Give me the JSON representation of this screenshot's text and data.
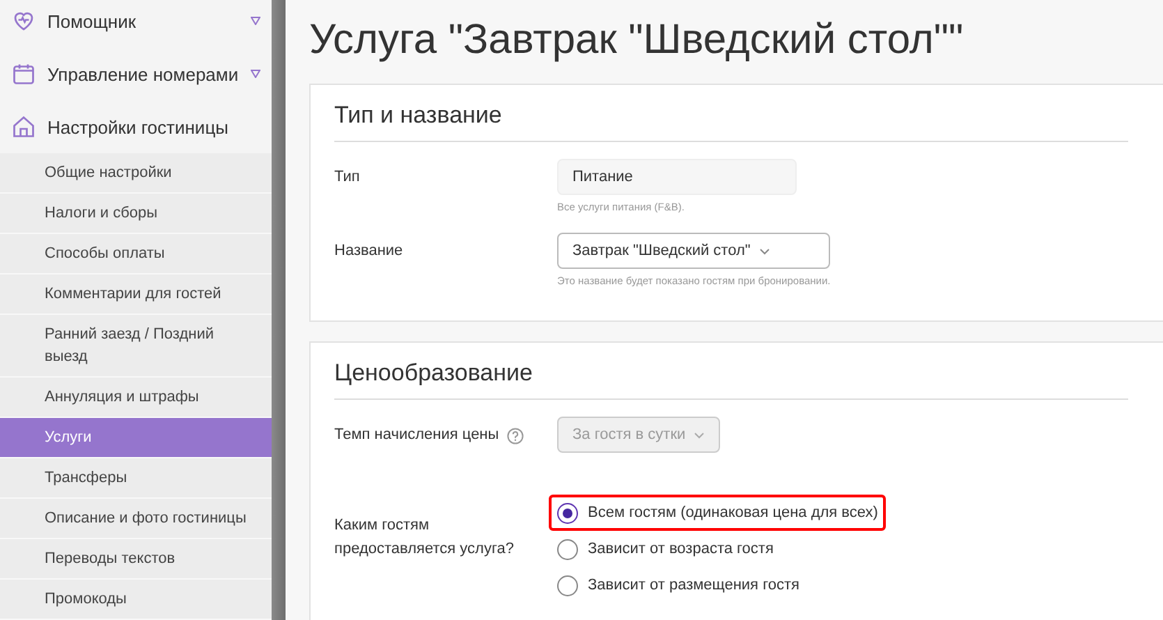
{
  "sidebar": {
    "items": [
      {
        "label": "Помощник",
        "expandable": true
      },
      {
        "label": "Управление номерами",
        "expandable": true
      },
      {
        "label": "Настройки гостиницы",
        "expandable": false,
        "children": [
          {
            "label": "Общие настройки",
            "selected": false
          },
          {
            "label": "Налоги и сборы",
            "selected": false
          },
          {
            "label": "Способы оплаты",
            "selected": false
          },
          {
            "label": "Комментарии для гостей",
            "selected": false
          },
          {
            "label": "Ранний заезд / Поздний выезд",
            "selected": false
          },
          {
            "label": "Аннуляция и штрафы",
            "selected": false
          },
          {
            "label": "Услуги",
            "selected": true
          },
          {
            "label": "Трансферы",
            "selected": false
          },
          {
            "label": "Описание и фото гостиницы",
            "selected": false
          },
          {
            "label": "Переводы текстов",
            "selected": false
          },
          {
            "label": "Промокоды",
            "selected": false
          }
        ]
      }
    ]
  },
  "page_title": "Услуга \"Завтрак \"Шведский стол\"\"",
  "sections": [
    {
      "title": "Тип и название",
      "fields": [
        {
          "kind": "input",
          "label": "Тип",
          "value": "Питание",
          "hint": "Все услуги питания (F&B)."
        },
        {
          "kind": "select",
          "label": "Название",
          "value": "Завтрак \"Шведский стол\"",
          "disabled": false,
          "hint": "Это название будет показано гостям при бронировании."
        }
      ]
    },
    {
      "title": "Ценообразование",
      "fields": [
        {
          "kind": "select",
          "label": "Темп начисления цены",
          "help": true,
          "value": "За гостя в сутки",
          "disabled": true
        },
        {
          "kind": "radio",
          "label": "Каким гостям предоставляется услуга?",
          "options": [
            {
              "label": "Всем гостям (одинаковая цена для всех)",
              "selected": true,
              "highlighted": true
            },
            {
              "label": "Зависит от возраста гостя",
              "selected": false,
              "highlighted": false
            },
            {
              "label": "Зависит от размещения гостя",
              "selected": false,
              "highlighted": false
            }
          ]
        }
      ]
    }
  ]
}
